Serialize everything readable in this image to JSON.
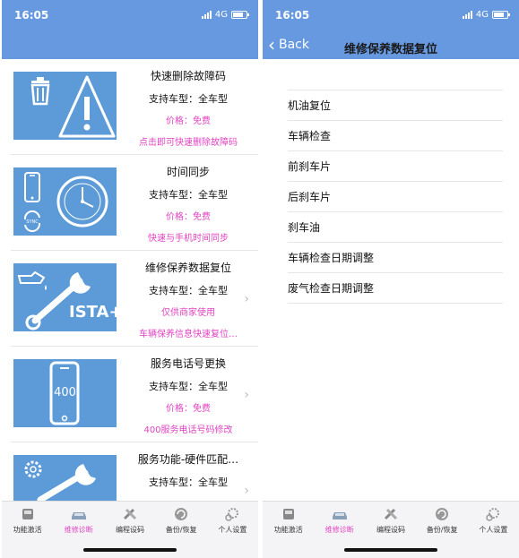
{
  "status": {
    "time": "16:05",
    "network": "4G"
  },
  "left": {
    "items": [
      {
        "title": "快速删除故障码",
        "support": "支持车型：全车型",
        "price": "价格：免费",
        "desc": "点击即可快速删除故障码"
      },
      {
        "title": "时间同步",
        "support": "支持车型：全车型",
        "price": "价格：免费",
        "desc": "快速与手机时间同步"
      },
      {
        "title": "维修保养数据复位",
        "support": "支持车型：全车型",
        "price": "仅供商家使用",
        "desc": "车辆保养信息快速复位…",
        "thumb_text": "ISTA+"
      },
      {
        "title": "服务电话号更换",
        "support": "支持车型：全车型",
        "price": "价格：免费",
        "desc": "400服务电话号码修改",
        "thumb_text": "400"
      },
      {
        "title": "服务功能-硬件匹配…",
        "support": "支持车型：全车型"
      }
    ]
  },
  "right": {
    "back_label": "Back",
    "nav_title": "维修保养数据复位",
    "items": [
      "机油复位",
      "车辆检查",
      "前刹车片",
      "后刹车片",
      "刹车油",
      "车辆检查日期调整",
      "废气检查日期调整"
    ]
  },
  "tabs": [
    "功能激活",
    "维修诊断",
    "编程设码",
    "备份/恢复",
    "个人设置"
  ],
  "colors": {
    "header": "#6799e0",
    "accent": "#e044c2",
    "thumb": "#5d9bd8"
  }
}
